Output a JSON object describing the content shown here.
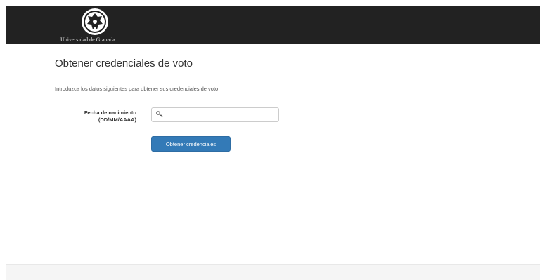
{
  "header": {
    "logo_text": "Universidad de Granada",
    "background_color": "#222222",
    "emblem_icon": "university-crest"
  },
  "page": {
    "title": "Obtener credenciales de voto",
    "intro": "Introduzca los datos siguientes para obtener sus credenciales de voto"
  },
  "form": {
    "birthdate_label": "Fecha de nacimiento (DD/MM/AAAA)",
    "birthdate_value": "",
    "birthdate_icon": "key-icon",
    "submit_label": "Obtener credenciales",
    "submit_color": "#337ab7"
  }
}
